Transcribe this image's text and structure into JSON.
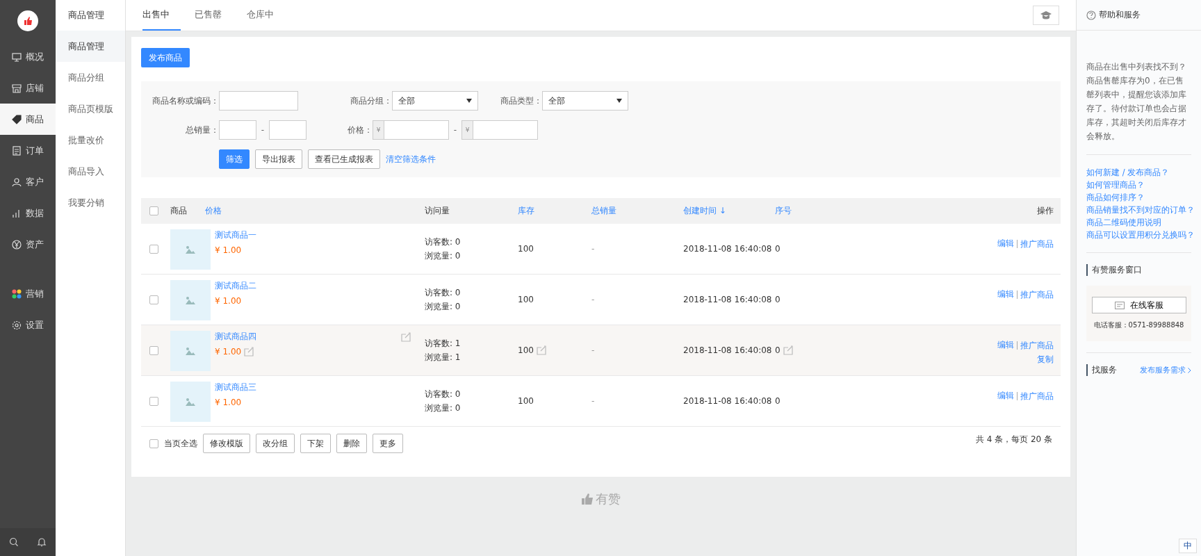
{
  "main_nav": [
    {
      "label": "概况",
      "selected": false
    },
    {
      "label": "店铺",
      "selected": false
    },
    {
      "label": "商品",
      "selected": true
    },
    {
      "label": "订单",
      "selected": false
    },
    {
      "label": "客户",
      "selected": false
    },
    {
      "label": "数据",
      "selected": false
    },
    {
      "label": "资产",
      "selected": false
    },
    {
      "label": "营销",
      "selected": false
    },
    {
      "label": "设置",
      "selected": false
    }
  ],
  "sub_nav": {
    "title": "商品管理",
    "items": [
      {
        "label": "商品管理",
        "selected": true
      },
      {
        "label": "商品分组",
        "selected": false
      },
      {
        "label": "商品页模版",
        "selected": false
      },
      {
        "label": "批量改价",
        "selected": false
      },
      {
        "label": "商品导入",
        "selected": false
      },
      {
        "label": "我要分销",
        "selected": false
      }
    ]
  },
  "tabs": [
    {
      "label": "出售中",
      "selected": true
    },
    {
      "label": "已售罄",
      "selected": false
    },
    {
      "label": "仓库中",
      "selected": false
    }
  ],
  "publish_button": "发布商品",
  "filters": {
    "name_label": "商品名称或编码：",
    "group_label": "商品分组：",
    "group_value": "全部",
    "type_label": "商品类型：",
    "type_value": "全部",
    "sales_label": "总销量：",
    "range_sep": "-",
    "price_label": "价格：",
    "currency": "¥",
    "buttons": [
      "筛选",
      "导出报表",
      "查看已生成报表"
    ],
    "clear_link": "清空筛选条件"
  },
  "table": {
    "columns": [
      {
        "label": "商品",
        "link": false
      },
      {
        "label": "价格",
        "link": true
      },
      {
        "label": "访问量",
        "link": false
      },
      {
        "label": "库存",
        "link": true
      },
      {
        "label": "总销量",
        "link": true
      },
      {
        "label": "创建时间 ↓",
        "link": true
      },
      {
        "label": "序号",
        "link": true
      },
      {
        "label": "操作",
        "link": false
      }
    ],
    "rows": [
      {
        "name": "测试商品一",
        "price": "¥ 1.00",
        "visitors": "访客数: 0",
        "views": "浏览量: 0",
        "stock": "100",
        "sales": "-",
        "created": "2018-11-08 16:40:08",
        "order": "0",
        "actions": [
          "编辑",
          "推广商品"
        ],
        "hovered": false,
        "checked": false
      },
      {
        "name": "测试商品二",
        "price": "¥ 1.00",
        "visitors": "访客数: 0",
        "views": "浏览量: 0",
        "stock": "100",
        "sales": "-",
        "created": "2018-11-08 16:40:08",
        "order": "0",
        "actions": [
          "编辑",
          "推广商品"
        ],
        "hovered": false,
        "checked": false
      },
      {
        "name": "测试商品四",
        "price": "¥ 1.00",
        "visitors": "访客数: 1",
        "views": "浏览量: 1",
        "stock": "100",
        "sales": "-",
        "created": "2018-11-08 16:40:08",
        "order": "0",
        "actions": [
          "编辑",
          "推广商品",
          "复制"
        ],
        "hovered": true,
        "checked": false
      },
      {
        "name": "测试商品三",
        "price": "¥ 1.00",
        "visitors": "访客数: 0",
        "views": "浏览量: 0",
        "stock": "100",
        "sales": "-",
        "created": "2018-11-08 16:40:08",
        "order": "0",
        "actions": [
          "编辑",
          "推广商品"
        ],
        "hovered": false,
        "checked": false
      }
    ],
    "header_checked": false,
    "select_all": {
      "label": "当页全选",
      "checked": false
    },
    "bulk_buttons": [
      "修改模版",
      "改分组",
      "下架",
      "删除",
      "更多"
    ],
    "summary": "共 4 条，每页 20 条"
  },
  "footer_brand": "有赞",
  "help": {
    "title": "帮助和服务",
    "intro": [
      "商品在出售中列表找不到？",
      "商品售罄库存为0，在已售罄列表中，提醒您该添加库存了。待付款订单也会占据库存，其超时关闭后库存才会释放。"
    ],
    "links": [
      "如何新建 / 发布商品？",
      "如何管理商品？",
      "商品如何排序？",
      "商品销量找不到对应的订单？",
      "商品二维码使用说明",
      "商品可以设置用积分兑换吗？"
    ],
    "service_title": "有赞服务窗口",
    "online_button": "在线客服",
    "phone": "电话客服：0571-89988848",
    "find_title": "找服务",
    "find_link": "发布服务需求"
  },
  "ime": "中"
}
